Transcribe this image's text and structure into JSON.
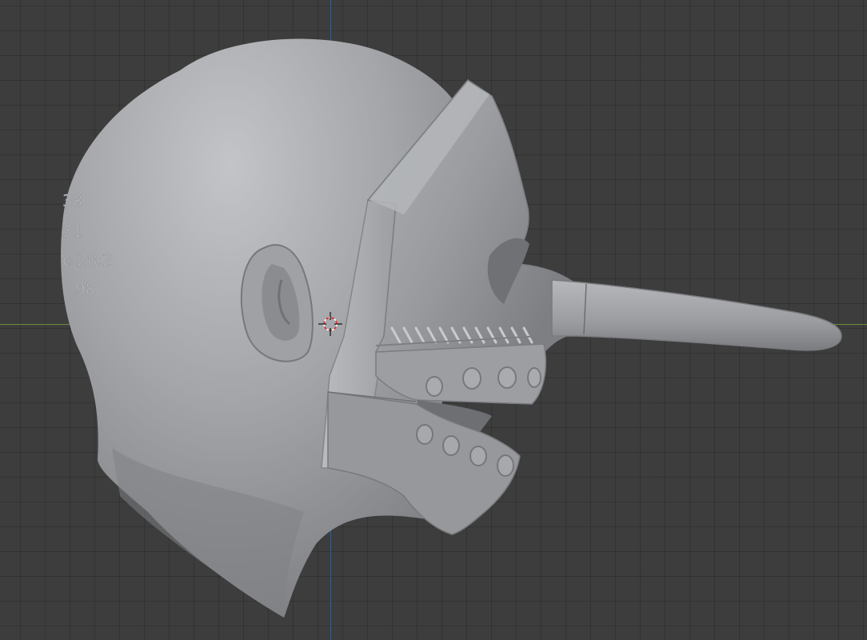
{
  "viewport": {
    "view": "3d-viewport-side-orthographic",
    "grid_visible": true,
    "background_color": "#3d3d3d",
    "x_axis_color": "#6c8a3a",
    "z_axis_color": "#3a5f8f"
  },
  "model": {
    "material_color": "#8f9196",
    "engraved_text": [
      "38",
      "31",
      "c-28.2",
      "98"
    ]
  },
  "cursor": {
    "icon": "3d-cursor-icon"
  }
}
